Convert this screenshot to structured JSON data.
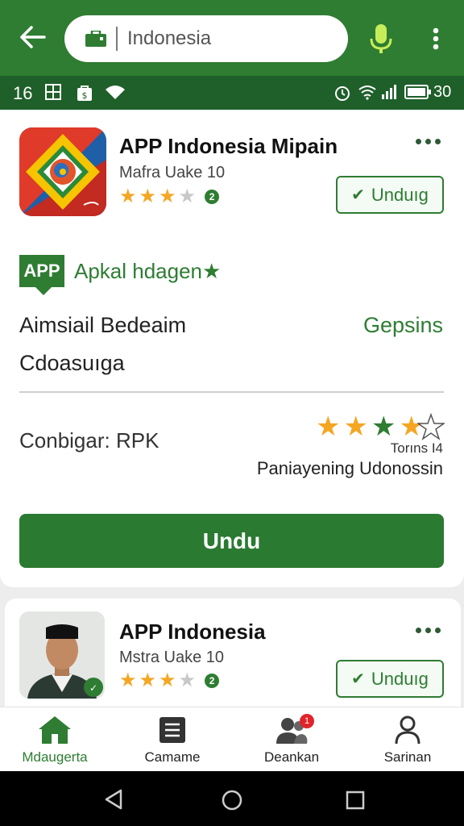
{
  "search": {
    "query": "Indonesia"
  },
  "status_bar": {
    "time": "16",
    "battery": "30"
  },
  "card1": {
    "app_name": "APP Indonesia Mipain",
    "subtitle": "Mafra Uake 10",
    "rating_stars": 3,
    "badge": "2",
    "install_label": "Unduıg",
    "tag_label": "APP",
    "tag_text": "Apkal hdagen★",
    "row1_left": "Aimsiail Bedeaim",
    "row1_right": "Gepsins",
    "row2_left": "Cdoasuıga",
    "config_label": "Conbigar: RPK",
    "rating_big": 3.5,
    "rating_caption": "Torıns I4",
    "rating_subtext": "Paniayening Udonossin",
    "main_button": "Undu"
  },
  "card2": {
    "app_name": "APP Indonesia",
    "subtitle": "Mstra Uake 10",
    "rating_stars": 3,
    "badge": "2",
    "install_label": "Unduıg"
  },
  "bottom_nav": [
    {
      "label": "Mdaugerta",
      "icon": "home-icon",
      "active": true
    },
    {
      "label": "Camame",
      "icon": "document-icon",
      "active": false
    },
    {
      "label": "Deankan",
      "icon": "people-icon",
      "active": false,
      "notification": "1"
    },
    {
      "label": "Sarinan",
      "icon": "person-icon",
      "active": false
    }
  ],
  "colors": {
    "primary": "#2e7d32",
    "status_bar": "#1f5f2a",
    "star": "#f5a623"
  }
}
